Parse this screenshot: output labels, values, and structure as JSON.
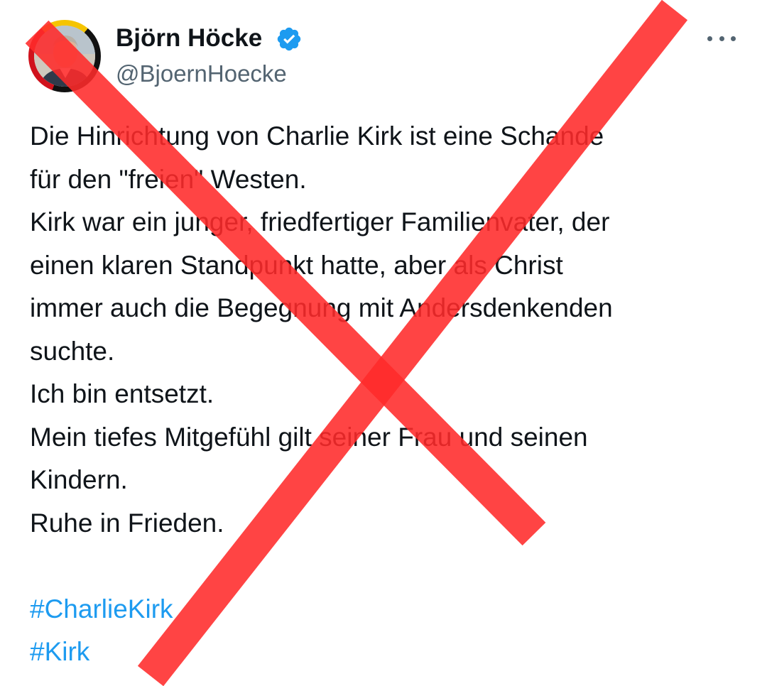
{
  "author": {
    "display_name": "Björn Höcke",
    "handle": "@BjoernHoecke",
    "verified": true,
    "avatar_icon": "profile-photo-icon",
    "verified_icon": "verified-badge-icon"
  },
  "menu": {
    "icon": "more-options-icon"
  },
  "tweet": {
    "lines": [
      "Die Hinrichtung von Charlie Kirk ist eine Schande",
      "für den \"freien\" Westen.",
      "Kirk war ein junger, friedfertiger Familienvater, der",
      "einen klaren Standpunkt hatte, aber als Christ",
      "immer auch die Begegnung mit Andersdenkenden",
      "suchte.",
      "Ich bin entsetzt.",
      "Mein tiefes Mitgefühl gilt seiner Frau und seinen",
      "Kindern.",
      "Ruhe in Frieden."
    ],
    "hashtags": [
      "#CharlieKirk",
      "#Kirk"
    ]
  },
  "overlay": {
    "icon": "red-x-cross-icon",
    "color": "#ff2a2a"
  },
  "colors": {
    "text": "#0f1419",
    "secondary": "#536471",
    "link": "#1d9bf0",
    "verified": "#1d9bf0"
  }
}
